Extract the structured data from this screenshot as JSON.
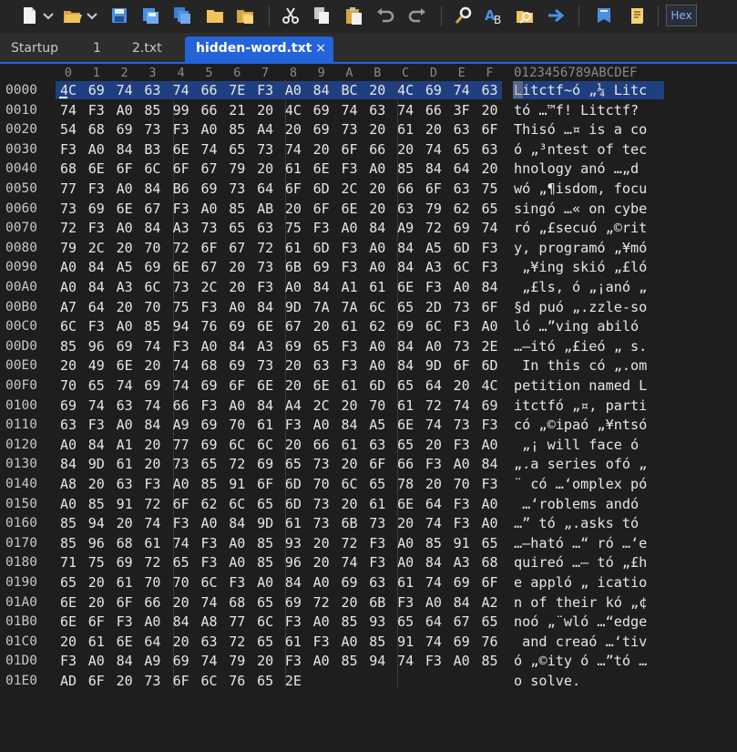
{
  "toolbar": {
    "icons": [
      "new-file-icon",
      "chevron-down-icon",
      "open-folder-icon",
      "chevron-down-icon",
      "save-icon",
      "save-as-icon",
      "save-all-icon",
      "folder-icon",
      "folder-open-icon",
      "cut-icon",
      "copy-icon",
      "paste-icon",
      "undo-icon",
      "redo-icon",
      "find-icon",
      "replace-icon",
      "find-in-files-icon",
      "goto-icon",
      "bookmark-icon",
      "script-icon"
    ],
    "hex_toggle_label": "Hex"
  },
  "tabs": [
    {
      "label": "Startup",
      "active": false
    },
    {
      "label": "1",
      "active": false
    },
    {
      "label": "2.txt",
      "active": false
    },
    {
      "label": "hidden-word.txt",
      "active": true,
      "close": "×"
    }
  ],
  "editor": {
    "column_headers": [
      "0",
      "1",
      "2",
      "3",
      "4",
      "5",
      "6",
      "7",
      "8",
      "9",
      "A",
      "B",
      "C",
      "D",
      "E",
      "F"
    ],
    "ascii_header": "0123456789ABCDEF",
    "rows": [
      {
        "offset": "0000",
        "bytes": [
          "4C",
          "69",
          "74",
          "63",
          "74",
          "66",
          "7E",
          "F3",
          "A0",
          "84",
          "BC",
          "20",
          "4C",
          "69",
          "74",
          "63"
        ],
        "ascii": "Litctf~ó „¼ Litc"
      },
      {
        "offset": "0010",
        "bytes": [
          "74",
          "F3",
          "A0",
          "85",
          "99",
          "66",
          "21",
          "20",
          "4C",
          "69",
          "74",
          "63",
          "74",
          "66",
          "3F",
          "20"
        ],
        "ascii": "tó …™f! Litctf? "
      },
      {
        "offset": "0020",
        "bytes": [
          "54",
          "68",
          "69",
          "73",
          "F3",
          "A0",
          "85",
          "A4",
          "20",
          "69",
          "73",
          "20",
          "61",
          "20",
          "63",
          "6F"
        ],
        "ascii": "Thisó …¤ is a co"
      },
      {
        "offset": "0030",
        "bytes": [
          "F3",
          "A0",
          "84",
          "B3",
          "6E",
          "74",
          "65",
          "73",
          "74",
          "20",
          "6F",
          "66",
          "20",
          "74",
          "65",
          "63"
        ],
        "ascii": "ó „³ntest of tec"
      },
      {
        "offset": "0040",
        "bytes": [
          "68",
          "6E",
          "6F",
          "6C",
          "6F",
          "67",
          "79",
          "20",
          "61",
          "6E",
          "F3",
          "A0",
          "85",
          "84",
          "64",
          "20"
        ],
        "ascii": "hnology anó …„d "
      },
      {
        "offset": "0050",
        "bytes": [
          "77",
          "F3",
          "A0",
          "84",
          "B6",
          "69",
          "73",
          "64",
          "6F",
          "6D",
          "2C",
          "20",
          "66",
          "6F",
          "63",
          "75"
        ],
        "ascii": "wó „¶isdom, focu"
      },
      {
        "offset": "0060",
        "bytes": [
          "73",
          "69",
          "6E",
          "67",
          "F3",
          "A0",
          "85",
          "AB",
          "20",
          "6F",
          "6E",
          "20",
          "63",
          "79",
          "62",
          "65"
        ],
        "ascii": "singó …« on cybe"
      },
      {
        "offset": "0070",
        "bytes": [
          "72",
          "F3",
          "A0",
          "84",
          "A3",
          "73",
          "65",
          "63",
          "75",
          "F3",
          "A0",
          "84",
          "A9",
          "72",
          "69",
          "74"
        ],
        "ascii": "ró „£secuó „©rit"
      },
      {
        "offset": "0080",
        "bytes": [
          "79",
          "2C",
          "20",
          "70",
          "72",
          "6F",
          "67",
          "72",
          "61",
          "6D",
          "F3",
          "A0",
          "84",
          "A5",
          "6D",
          "F3"
        ],
        "ascii": "y, programó „¥mó"
      },
      {
        "offset": "0090",
        "bytes": [
          "A0",
          "84",
          "A5",
          "69",
          "6E",
          "67",
          "20",
          "73",
          "6B",
          "69",
          "F3",
          "A0",
          "84",
          "A3",
          "6C",
          "F3"
        ],
        "ascii": " „¥ing skió „£ló"
      },
      {
        "offset": "00A0",
        "bytes": [
          "A0",
          "84",
          "A3",
          "6C",
          "73",
          "2C",
          "20",
          "F3",
          "A0",
          "84",
          "A1",
          "61",
          "6E",
          "F3",
          "A0",
          "84"
        ],
        "ascii": " „£ls, ó „¡anó „"
      },
      {
        "offset": "00B0",
        "bytes": [
          "A7",
          "64",
          "20",
          "70",
          "75",
          "F3",
          "A0",
          "84",
          "9D",
          "7A",
          "7A",
          "6C",
          "65",
          "2D",
          "73",
          "6F"
        ],
        "ascii": "§d puó „.zzle-so"
      },
      {
        "offset": "00C0",
        "bytes": [
          "6C",
          "F3",
          "A0",
          "85",
          "94",
          "76",
          "69",
          "6E",
          "67",
          "20",
          "61",
          "62",
          "69",
          "6C",
          "F3",
          "A0"
        ],
        "ascii": "ló …”ving abiló "
      },
      {
        "offset": "00D0",
        "bytes": [
          "85",
          "96",
          "69",
          "74",
          "F3",
          "A0",
          "84",
          "A3",
          "69",
          "65",
          "F3",
          "A0",
          "84",
          "A0",
          "73",
          "2E"
        ],
        "ascii": "…–itó „£ieó „ s."
      },
      {
        "offset": "00E0",
        "bytes": [
          "20",
          "49",
          "6E",
          "20",
          "74",
          "68",
          "69",
          "73",
          "20",
          "63",
          "F3",
          "A0",
          "84",
          "9D",
          "6F",
          "6D"
        ],
        "ascii": " In this có „.om"
      },
      {
        "offset": "00F0",
        "bytes": [
          "70",
          "65",
          "74",
          "69",
          "74",
          "69",
          "6F",
          "6E",
          "20",
          "6E",
          "61",
          "6D",
          "65",
          "64",
          "20",
          "4C"
        ],
        "ascii": "petition named L"
      },
      {
        "offset": "0100",
        "bytes": [
          "69",
          "74",
          "63",
          "74",
          "66",
          "F3",
          "A0",
          "84",
          "A4",
          "2C",
          "20",
          "70",
          "61",
          "72",
          "74",
          "69"
        ],
        "ascii": "itctfó „¤, parti"
      },
      {
        "offset": "0110",
        "bytes": [
          "63",
          "F3",
          "A0",
          "84",
          "A9",
          "69",
          "70",
          "61",
          "F3",
          "A0",
          "84",
          "A5",
          "6E",
          "74",
          "73",
          "F3"
        ],
        "ascii": "có „©ipaó „¥ntsó"
      },
      {
        "offset": "0120",
        "bytes": [
          "A0",
          "84",
          "A1",
          "20",
          "77",
          "69",
          "6C",
          "6C",
          "20",
          "66",
          "61",
          "63",
          "65",
          "20",
          "F3",
          "A0"
        ],
        "ascii": " „¡ will face ó "
      },
      {
        "offset": "0130",
        "bytes": [
          "84",
          "9D",
          "61",
          "20",
          "73",
          "65",
          "72",
          "69",
          "65",
          "73",
          "20",
          "6F",
          "66",
          "F3",
          "A0",
          "84"
        ],
        "ascii": "„.a series ofó „"
      },
      {
        "offset": "0140",
        "bytes": [
          "A8",
          "20",
          "63",
          "F3",
          "A0",
          "85",
          "91",
          "6F",
          "6D",
          "70",
          "6C",
          "65",
          "78",
          "20",
          "70",
          "F3"
        ],
        "ascii": "¨ có …‘omplex pó"
      },
      {
        "offset": "0150",
        "bytes": [
          "A0",
          "85",
          "91",
          "72",
          "6F",
          "62",
          "6C",
          "65",
          "6D",
          "73",
          "20",
          "61",
          "6E",
          "64",
          "F3",
          "A0"
        ],
        "ascii": " …‘roblems andó "
      },
      {
        "offset": "0160",
        "bytes": [
          "85",
          "94",
          "20",
          "74",
          "F3",
          "A0",
          "84",
          "9D",
          "61",
          "73",
          "6B",
          "73",
          "20",
          "74",
          "F3",
          "A0"
        ],
        "ascii": "…” tó „.asks tó "
      },
      {
        "offset": "0170",
        "bytes": [
          "85",
          "96",
          "68",
          "61",
          "74",
          "F3",
          "A0",
          "85",
          "93",
          "20",
          "72",
          "F3",
          "A0",
          "85",
          "91",
          "65"
        ],
        "ascii": "…–ható …“ ró …‘e"
      },
      {
        "offset": "0180",
        "bytes": [
          "71",
          "75",
          "69",
          "72",
          "65",
          "F3",
          "A0",
          "85",
          "96",
          "20",
          "74",
          "F3",
          "A0",
          "84",
          "A3",
          "68"
        ],
        "ascii": "quireó …– tó „£h"
      },
      {
        "offset": "0190",
        "bytes": [
          "65",
          "20",
          "61",
          "70",
          "70",
          "6C",
          "F3",
          "A0",
          "84",
          "A0",
          "69",
          "63",
          "61",
          "74",
          "69",
          "6F"
        ],
        "ascii": "e appló „ icatio"
      },
      {
        "offset": "01A0",
        "bytes": [
          "6E",
          "20",
          "6F",
          "66",
          "20",
          "74",
          "68",
          "65",
          "69",
          "72",
          "20",
          "6B",
          "F3",
          "A0",
          "84",
          "A2"
        ],
        "ascii": "n of their kó „¢"
      },
      {
        "offset": "01B0",
        "bytes": [
          "6E",
          "6F",
          "F3",
          "A0",
          "84",
          "A8",
          "77",
          "6C",
          "F3",
          "A0",
          "85",
          "93",
          "65",
          "64",
          "67",
          "65"
        ],
        "ascii": "noó „¨wló …“edge"
      },
      {
        "offset": "01C0",
        "bytes": [
          "20",
          "61",
          "6E",
          "64",
          "20",
          "63",
          "72",
          "65",
          "61",
          "F3",
          "A0",
          "85",
          "91",
          "74",
          "69",
          "76"
        ],
        "ascii": " and creaó …‘tiv"
      },
      {
        "offset": "01D0",
        "bytes": [
          "F3",
          "A0",
          "84",
          "A9",
          "69",
          "74",
          "79",
          "20",
          "F3",
          "A0",
          "85",
          "94",
          "74",
          "F3",
          "A0",
          "85"
        ],
        "ascii": "ó „©ity ó …”tó …"
      },
      {
        "offset": "01E0",
        "bytes": [
          "AD",
          "6F",
          "20",
          "73",
          "6F",
          "6C",
          "76",
          "65",
          "2E"
        ],
        "ascii": "­o solve."
      }
    ]
  },
  "colors": {
    "background": "#1e1e1e",
    "toolbar": "#252526",
    "tab_active": "#2563d9",
    "selection": "#1f3f80",
    "text": "#e6e6e6",
    "muted": "#8a8a8a"
  }
}
